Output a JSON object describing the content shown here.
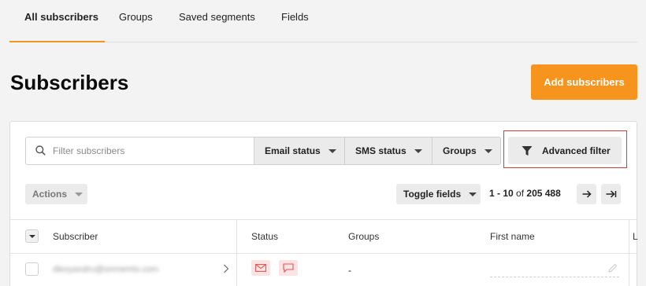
{
  "tabs": [
    {
      "label": "All subscribers",
      "active": true
    },
    {
      "label": "Groups",
      "active": false
    },
    {
      "label": "Saved segments",
      "active": false
    },
    {
      "label": "Fields",
      "active": false
    }
  ],
  "page": {
    "title": "Subscribers",
    "add_button": "Add subscribers"
  },
  "filters": {
    "search_placeholder": "Filter subscribers",
    "email_status": "Email status",
    "sms_status": "SMS status",
    "groups": "Groups",
    "advanced_filter": "Advanced filter"
  },
  "toolbar": {
    "actions": "Actions",
    "toggle_fields": "Toggle fields",
    "pagination_range": "1 - 10",
    "pagination_of": "of",
    "pagination_total": "205 488"
  },
  "table": {
    "headers": {
      "subscriber": "Subscriber",
      "status": "Status",
      "groups": "Groups",
      "first_name": "First name",
      "last_cut": "L"
    },
    "rows": [
      {
        "email": "dlexyandru@onmemts.com",
        "groups": "-",
        "first_name": ""
      }
    ]
  },
  "colors": {
    "accent": "#f7941d",
    "highlight": "#d83a3a",
    "status_bg": "#fce4e4",
    "status_icon": "#e05555"
  },
  "icons": [
    "search-icon",
    "caret-down-icon",
    "filter-icon",
    "arrow-right-icon",
    "arrow-last-icon",
    "chevron-right-icon",
    "email-status-icon",
    "sms-status-icon",
    "pencil-icon"
  ]
}
